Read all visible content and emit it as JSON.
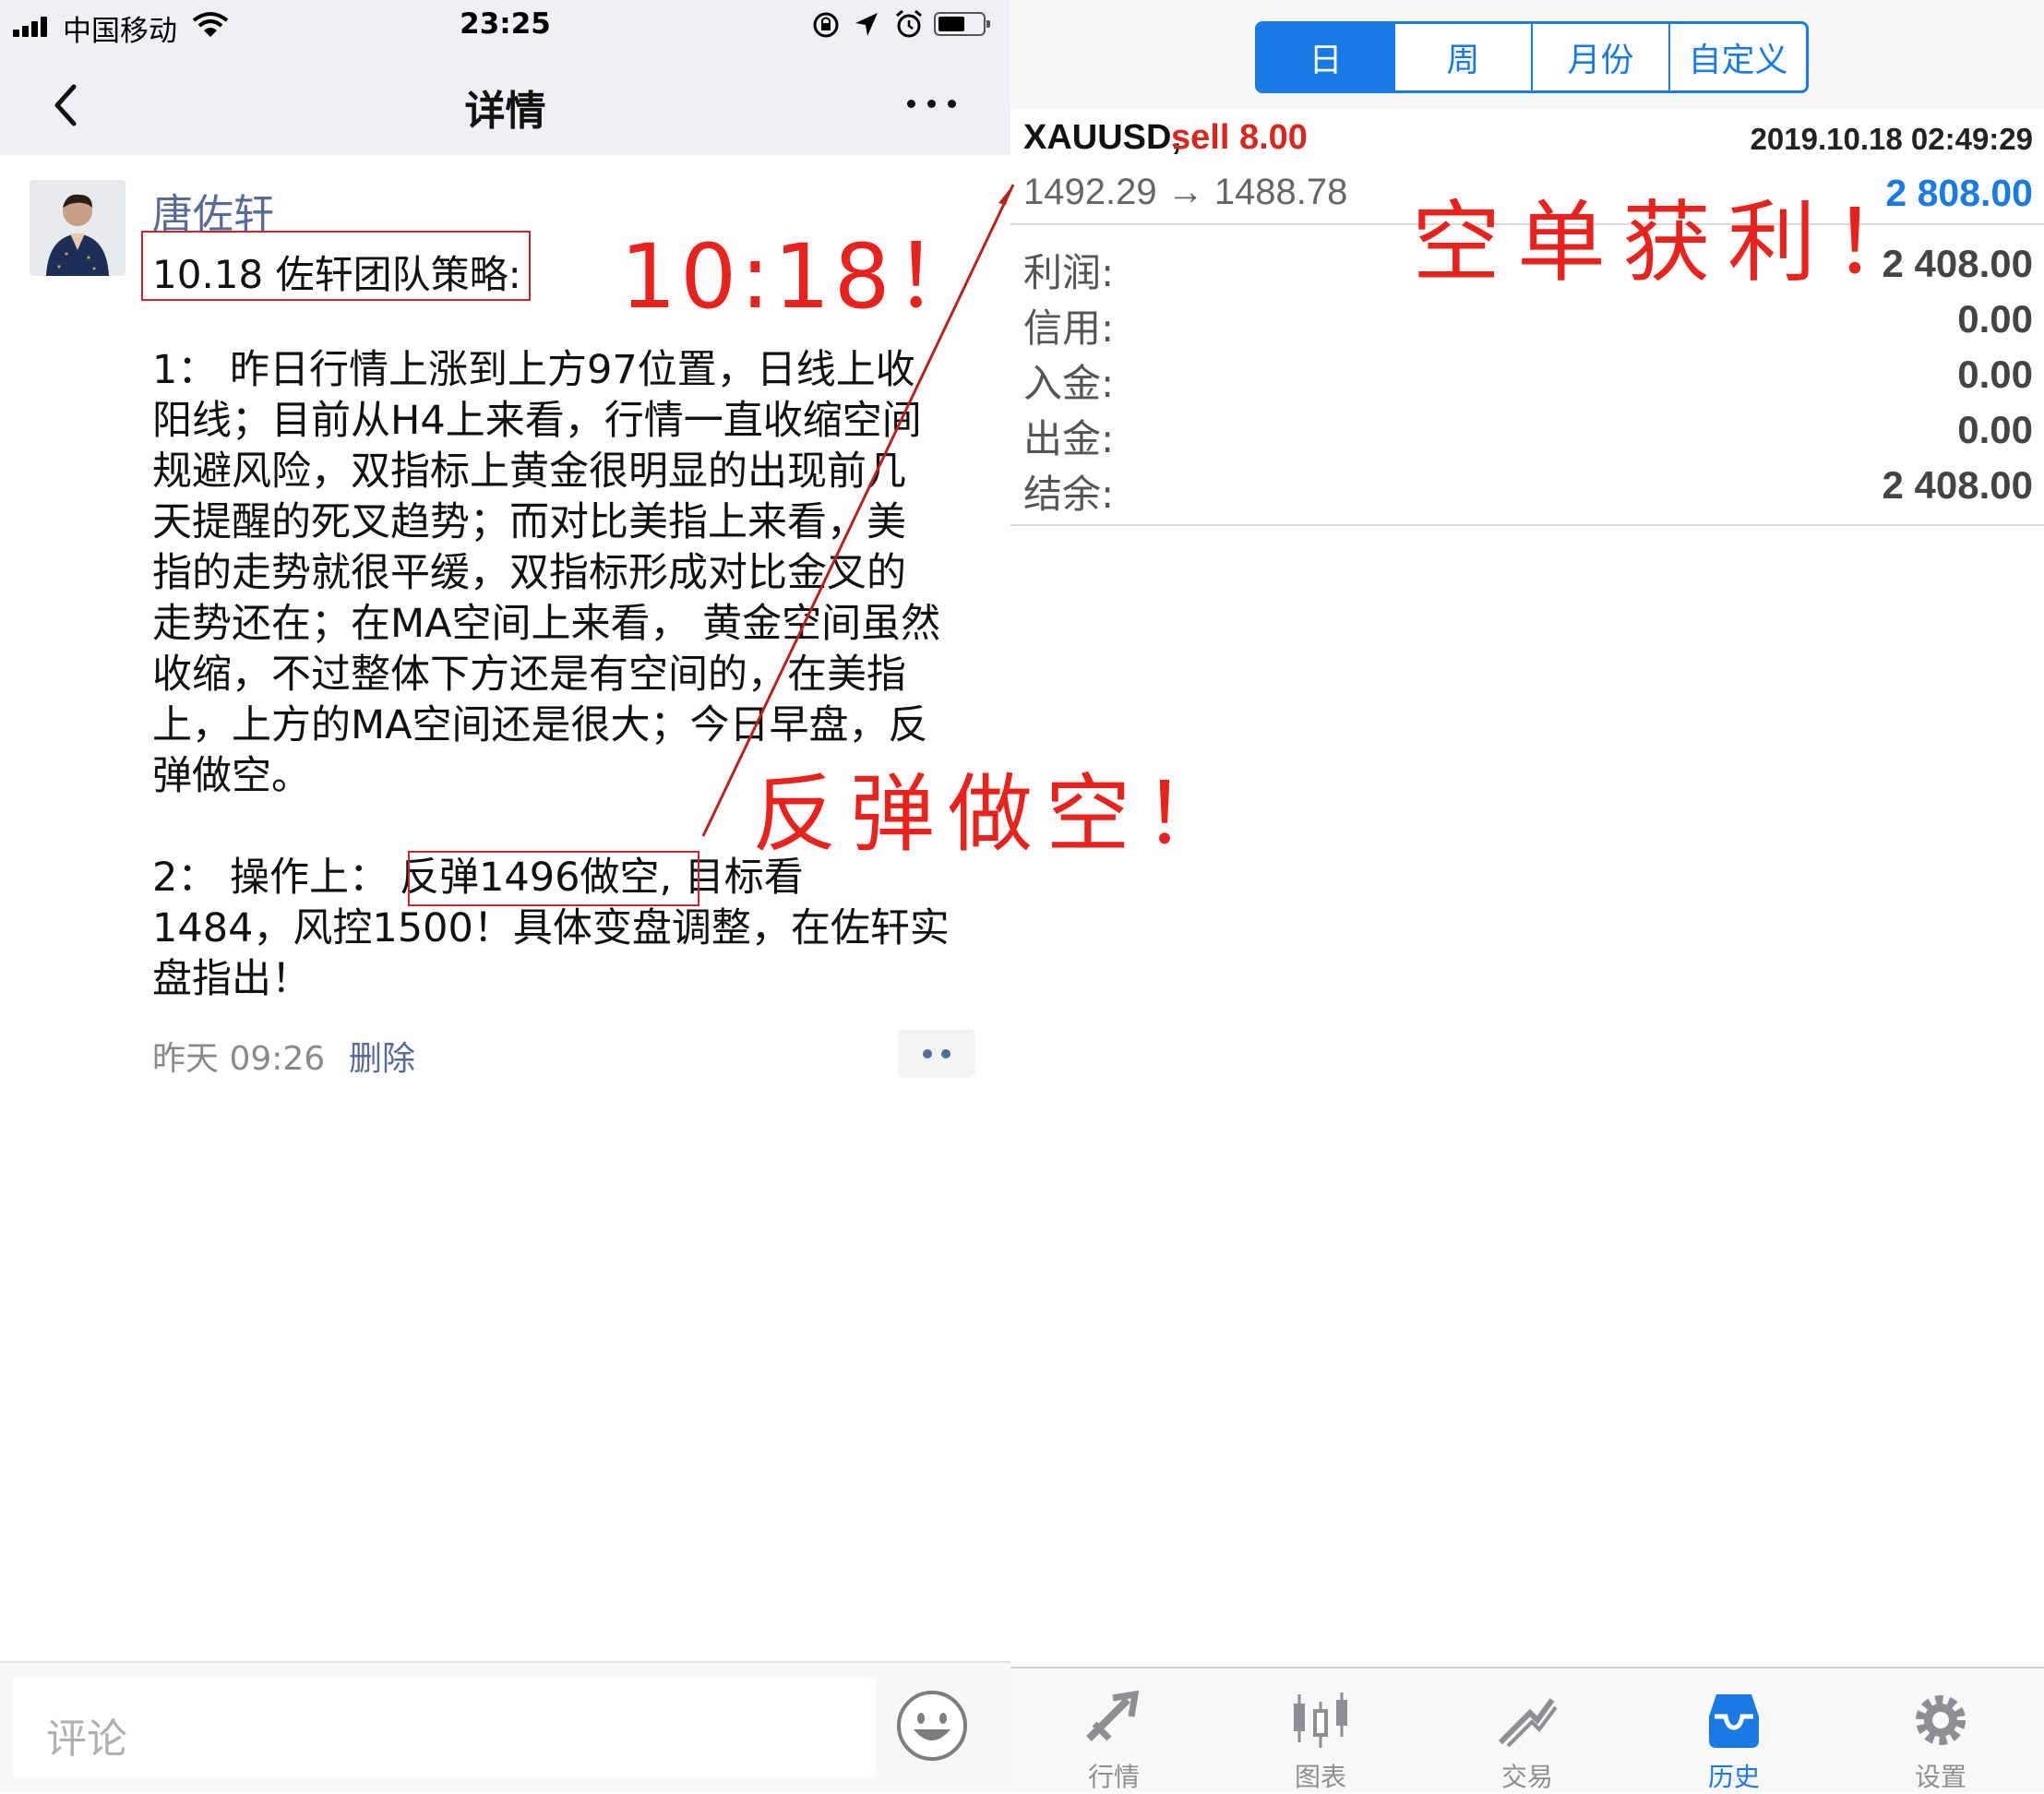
{
  "left": {
    "status_bar": {
      "carrier": "中国移动",
      "time": "23:25"
    },
    "nav": {
      "title": "详情"
    },
    "post": {
      "author": "唐佐轩",
      "headline": "10.18 佐轩团队策略:",
      "paragraph1": [
        "1：  昨日行情上涨到上方97位置，日线上收",
        "阳线；目前从H4上来看，行情一直收缩空间",
        "规避风险，双指标上黄金很明显的出现前几",
        "天提醒的死叉趋势；而对比美指上来看，美",
        "指的走势就很平缓，双指标形成对比金叉的",
        "走势还在；在MA空间上来看， 黄金空间虽然",
        "收缩，不过整体下方还是有空间的，在美指",
        "上，上方的MA空间还是很大；今日早盘，反",
        "弹做空。"
      ],
      "paragraph2": {
        "prefix": "2：  操作上：",
        "highlight": "反弹1496做空,",
        "suffix": " 目标看",
        "line2": "1484，风控1500！具体变盘调整，在佐轩实",
        "line3": "盘指出！"
      },
      "time": "昨天 09:26",
      "delete_label": "删除"
    },
    "comment": {
      "placeholder": "评论"
    }
  },
  "right": {
    "period_tabs": [
      "日",
      "周",
      "月份",
      "自定义"
    ],
    "selected_period": "日",
    "trade": {
      "symbol": "XAUUSD,",
      "type": "sell 8.00",
      "datetime": "2019.10.18 02:49:29",
      "prices": "1492.29 → 1488.78",
      "profit": "2 808.00"
    },
    "summary": [
      {
        "label": "利润:",
        "value": "2 408.00"
      },
      {
        "label": "信用:",
        "value": "0.00"
      },
      {
        "label": "入金:",
        "value": "0.00"
      },
      {
        "label": "出金:",
        "value": "0.00"
      },
      {
        "label": "结余:",
        "value": "2 408.00"
      }
    ],
    "tab_bar": [
      {
        "label": "行情",
        "icon": "quotes-icon"
      },
      {
        "label": "图表",
        "icon": "chart-icon"
      },
      {
        "label": "交易",
        "icon": "trade-icon"
      },
      {
        "label": "历史",
        "icon": "history-icon"
      },
      {
        "label": "设置",
        "icon": "settings-icon"
      }
    ],
    "active_tab": "历史"
  },
  "annotations": {
    "date": "10:18！",
    "rebound_short": "反弹做空！",
    "short_profit": "空单获利！"
  },
  "colors": {
    "annotation_red": "#e8231e",
    "mt4_blue": "#1a7ae4",
    "sell_red": "#d6281e",
    "wechat_link": "#576b95"
  }
}
